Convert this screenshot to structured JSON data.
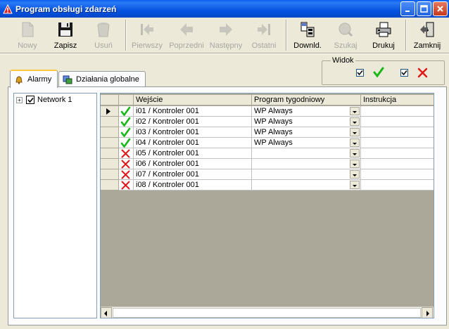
{
  "window": {
    "title": "Program obsługi zdarzeń"
  },
  "toolbar": {
    "new": "Nowy",
    "save": "Zapisz",
    "delete": "Usuń",
    "first": "Pierwszy",
    "prev": "Poprzedni",
    "next": "Następny",
    "last": "Ostatni",
    "download": "Downld.",
    "search": "Szukaj",
    "print": "Drukuj",
    "close": "Zamknij"
  },
  "view": {
    "legend": "Widok",
    "show_ok": true,
    "show_error": true
  },
  "tabs": [
    {
      "label": "Alarmy",
      "active": true
    },
    {
      "label": "Działania globalne",
      "active": false
    }
  ],
  "tree": {
    "items": [
      {
        "label": "Network 1",
        "checked": true,
        "expandable": true
      }
    ]
  },
  "grid": {
    "columns": [
      "Wejście",
      "Program tygodniowy",
      "Instrukcja"
    ],
    "rows": [
      {
        "status": "ok",
        "input": "i01 / Kontroler 001",
        "program": "WP Always",
        "instruction": "",
        "current": true
      },
      {
        "status": "ok",
        "input": "i02 / Kontroler 001",
        "program": "WP Always",
        "instruction": ""
      },
      {
        "status": "ok",
        "input": "i03 / Kontroler 001",
        "program": "WP Always",
        "instruction": ""
      },
      {
        "status": "ok",
        "input": "i04 / Kontroler 001",
        "program": "WP Always",
        "instruction": ""
      },
      {
        "status": "error",
        "input": "i05 / Kontroler 001",
        "program": "",
        "instruction": ""
      },
      {
        "status": "error",
        "input": "i06 / Kontroler 001",
        "program": "",
        "instruction": ""
      },
      {
        "status": "error",
        "input": "i07 / Kontroler 001",
        "program": "",
        "instruction": ""
      },
      {
        "status": "error",
        "input": "i08 / Kontroler 001",
        "program": "",
        "instruction": ""
      }
    ]
  },
  "colors": {
    "ok": "#18b818",
    "error": "#e01818",
    "title_bar": "#0553e0"
  }
}
